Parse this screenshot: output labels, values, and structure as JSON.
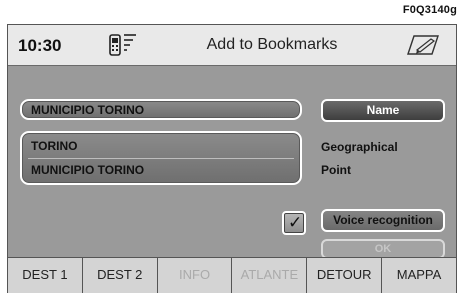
{
  "figure_code": "F0Q3140g",
  "header": {
    "time": "10:30",
    "title": "Add to Bookmarks",
    "phone_icon": "phone-signal-icon",
    "edit_icon": "keyboard-edit-icon"
  },
  "form": {
    "name_value": "MUNICIPIO TORINO",
    "address_line1": "TORINO",
    "address_line2": "MUNICIPIO TORINO",
    "name_button": "Name",
    "type_line1": "Geographical",
    "type_line2": "Point",
    "voice_checkbox_checked": true,
    "voice_button": "Voice recognition",
    "ok_button": "OK"
  },
  "tabs": [
    {
      "label": "DEST 1",
      "enabled": true
    },
    {
      "label": "DEST 2",
      "enabled": true
    },
    {
      "label": "INFO",
      "enabled": false
    },
    {
      "label": "ATLANTE",
      "enabled": false
    },
    {
      "label": "DETOUR",
      "enabled": true
    },
    {
      "label": "MAPPA",
      "enabled": true
    }
  ]
}
